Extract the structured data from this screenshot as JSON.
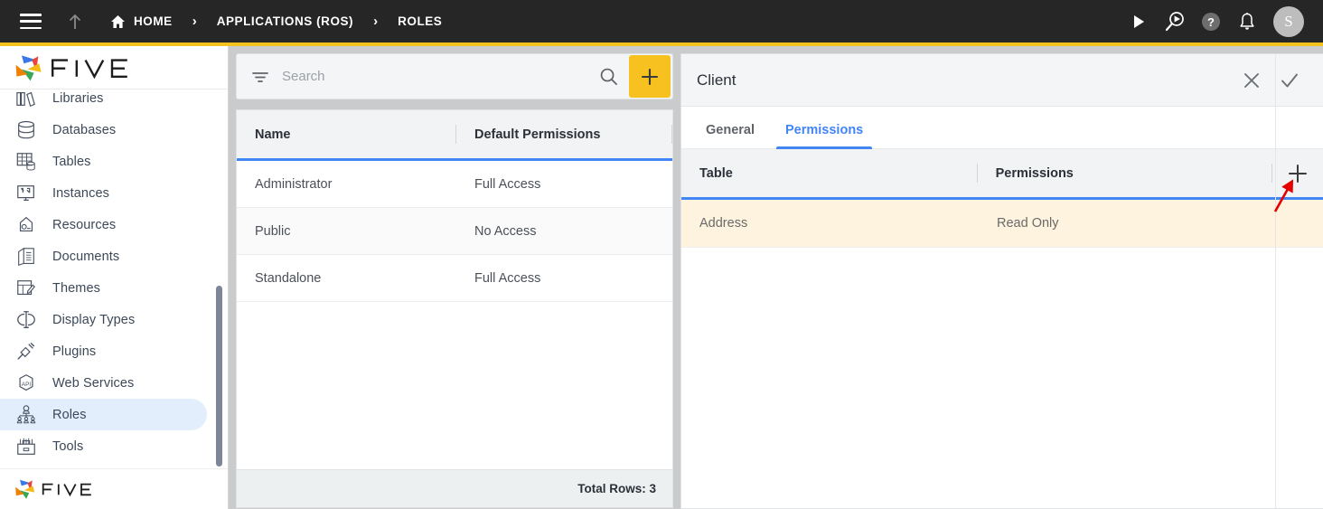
{
  "topbar": {
    "menu_icon": "hamburger-icon",
    "up_icon": "arrow-up-icon",
    "breadcrumbs": [
      {
        "label": "HOME",
        "icon": "home-icon"
      },
      {
        "label": "APPLICATIONS (ROS)",
        "icon": ""
      },
      {
        "label": "ROLES",
        "icon": ""
      }
    ],
    "separator": "›",
    "actions": [
      {
        "name": "run-icon",
        "label": "Run"
      },
      {
        "name": "debug-icon",
        "label": "Debug"
      },
      {
        "name": "help-icon",
        "label": "Help"
      },
      {
        "name": "notifications-icon",
        "label": "Notifications"
      }
    ],
    "avatar_initial": "S"
  },
  "sidebar": {
    "logo_text": "FIVE",
    "items": [
      {
        "label": "Libraries",
        "icon": "libraries-icon",
        "active": false
      },
      {
        "label": "Databases",
        "icon": "database-icon",
        "active": false
      },
      {
        "label": "Tables",
        "icon": "table-icon",
        "active": false
      },
      {
        "label": "Instances",
        "icon": "instances-icon",
        "active": false
      },
      {
        "label": "Resources",
        "icon": "resources-icon",
        "active": false
      },
      {
        "label": "Documents",
        "icon": "documents-icon",
        "active": false
      },
      {
        "label": "Themes",
        "icon": "themes-icon",
        "active": false
      },
      {
        "label": "Display Types",
        "icon": "display-types-icon",
        "active": false
      },
      {
        "label": "Plugins",
        "icon": "plugins-icon",
        "active": false
      },
      {
        "label": "Web Services",
        "icon": "web-services-icon",
        "active": false
      },
      {
        "label": "Roles",
        "icon": "roles-icon",
        "active": true
      },
      {
        "label": "Tools",
        "icon": "tools-icon",
        "active": false
      }
    ]
  },
  "list_panel": {
    "search": {
      "placeholder": "Search",
      "value": "",
      "filter_icon": "filter-icon",
      "search_icon": "search-icon",
      "add_icon": "plus-icon"
    },
    "columns": [
      "Name",
      "Default Permissions"
    ],
    "rows": [
      {
        "name": "Administrator",
        "permissions": "Full Access"
      },
      {
        "name": "Public",
        "permissions": "No Access"
      },
      {
        "name": "Standalone",
        "permissions": "Full Access"
      }
    ],
    "footer": "Total Rows: 3"
  },
  "detail_panel": {
    "title": "Client",
    "close_icon": "close-icon",
    "confirm_icon": "check-icon",
    "tabs": [
      {
        "label": "General",
        "active": false
      },
      {
        "label": "Permissions",
        "active": true
      }
    ],
    "columns": [
      "Table",
      "Permissions"
    ],
    "add_icon": "plus-icon",
    "rows": [
      {
        "table": "Address",
        "permissions": "Read Only"
      }
    ]
  },
  "annotation": {
    "type": "arrow",
    "color": "#e60000",
    "points_to": "detail-permissions-add-button"
  },
  "colors": {
    "accent_yellow": "#f4c21f",
    "brand_blue": "#4285f4",
    "topbar_dark": "#262626",
    "selected_row": "#fdf3de",
    "sidebar_active": "#e3eefc",
    "annotation_red": "#e60000"
  }
}
